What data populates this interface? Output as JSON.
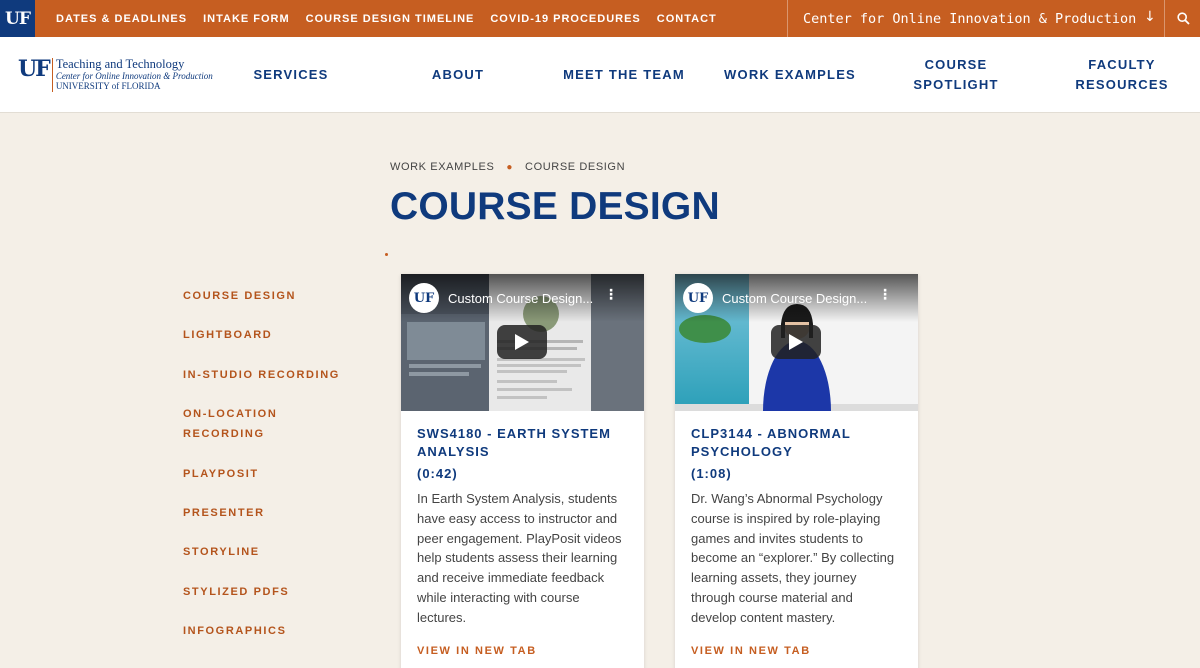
{
  "topbar": {
    "logo": "UF",
    "links": [
      "DATES & DEADLINES",
      "INTAKE FORM",
      "COURSE DESIGN TIMELINE",
      "COVID-19 PROCEDURES",
      "CONTACT"
    ],
    "center_name": "Center for Online Innovation & Production",
    "dropdown_icon": "arrow-down-icon",
    "search_icon": "search-icon"
  },
  "header": {
    "logo_uf": "UF",
    "logo_line1": "Teaching and Technology",
    "logo_line2": "Center for Online Innovation & Production",
    "logo_line3": "UNIVERSITY of FLORIDA",
    "nav": [
      "SERVICES",
      "ABOUT",
      "MEET THE TEAM",
      "WORK EXAMPLES",
      "COURSE SPOTLIGHT",
      "FACULTY RESOURCES"
    ]
  },
  "breadcrumb": [
    "WORK EXAMPLES",
    "COURSE DESIGN"
  ],
  "page_title": "COURSE DESIGN",
  "sidebar": {
    "items": [
      "COURSE DESIGN",
      "LIGHTBOARD",
      "IN-STUDIO RECORDING",
      "ON-LOCATION RECORDING",
      "PLAYPOSIT",
      "PRESENTER",
      "STORYLINE",
      "STYLIZED PDFS",
      "INFOGRAPHICS"
    ]
  },
  "cards": [
    {
      "video_logo": "UF",
      "video_title": "Custom Course Design...",
      "title": "SWS4180 - EARTH SYSTEM ANALYSIS",
      "duration": "(0:42)",
      "description": "In Earth System Analysis, students have easy access to instructor and peer engagement. PlayPosit videos help students assess their learning and receive immediate feedback while interacting with course lectures.",
      "link": "VIEW IN NEW TAB"
    },
    {
      "video_logo": "UF",
      "video_title": "Custom Course Design...",
      "title": "CLP3144 - ABNORMAL PSYCHOLOGY",
      "duration": "(1:08)",
      "description": "Dr. Wang’s Abnormal Psychology course is inspired by role-playing games and invites students to become an “explorer.” By collecting learning assets, they journey through course material and develop content mastery.",
      "link": "VIEW IN NEW TAB"
    }
  ],
  "colors": {
    "orange": "#c65e21",
    "navy": "#0f3a7d",
    "background": "#f4efe7"
  }
}
